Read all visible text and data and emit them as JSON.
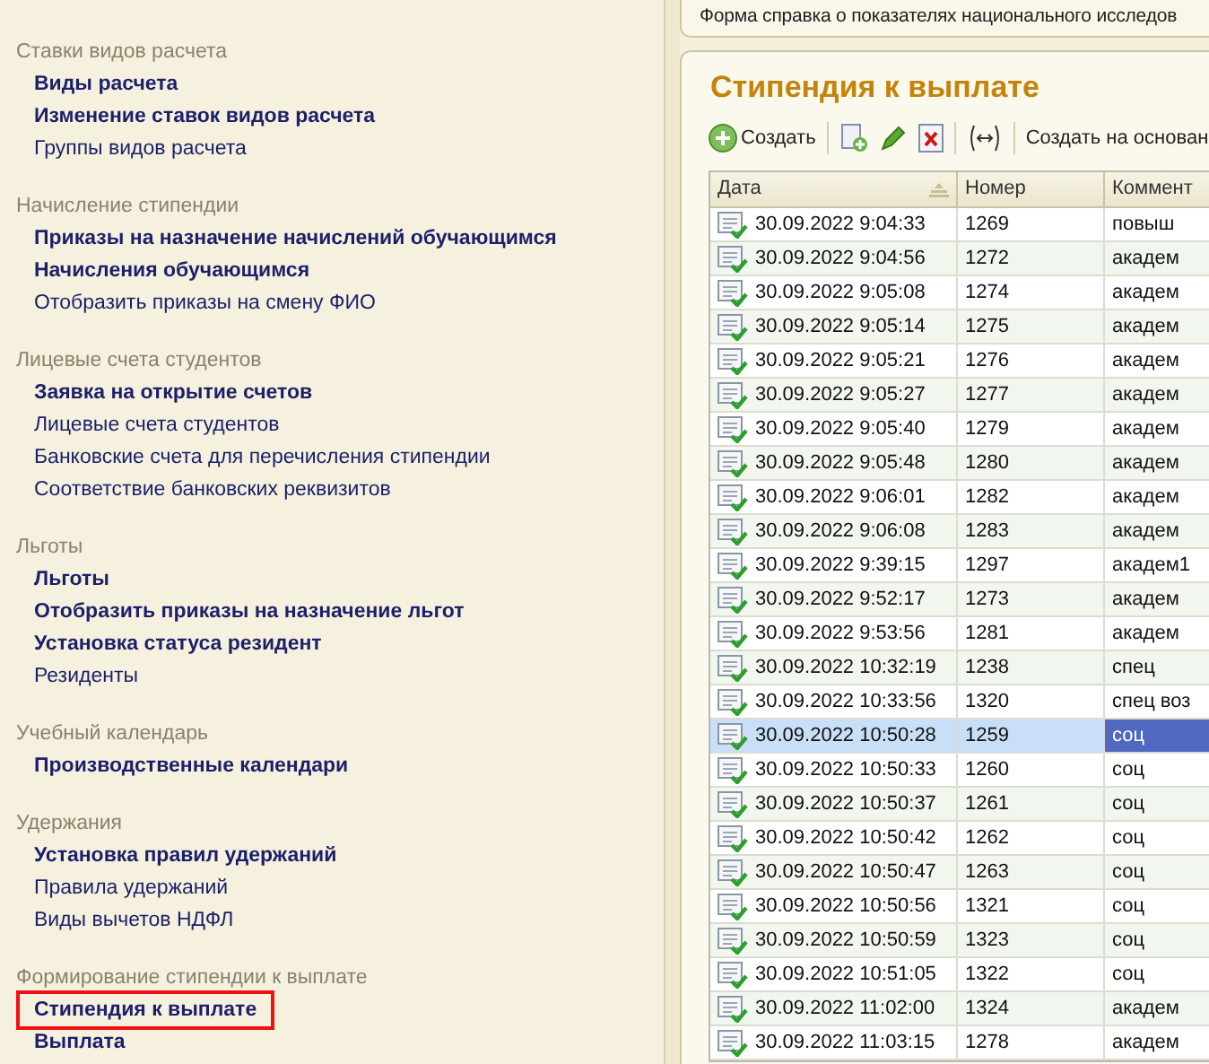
{
  "sidebar": {
    "sections": [
      {
        "title": "Ставки видов расчета",
        "items": [
          {
            "label": "Виды расчета",
            "bold": true,
            "outlined": false
          },
          {
            "label": "Изменение ставок видов расчета",
            "bold": true,
            "outlined": false
          },
          {
            "label": "Группы видов расчета",
            "bold": false,
            "outlined": false
          }
        ]
      },
      {
        "title": "Начисление стипендии",
        "items": [
          {
            "label": "Приказы на назначение начислений обучающимся",
            "bold": true,
            "outlined": false
          },
          {
            "label": "Начисления обучающимся",
            "bold": true,
            "outlined": false
          },
          {
            "label": "Отобразить приказы на смену ФИО",
            "bold": false,
            "outlined": false
          }
        ]
      },
      {
        "title": "Лицевые счета студентов",
        "items": [
          {
            "label": "Заявка на открытие счетов",
            "bold": true,
            "outlined": false
          },
          {
            "label": "Лицевые счета студентов",
            "bold": false,
            "outlined": false
          },
          {
            "label": "Банковские счета для перечисления стипендии",
            "bold": false,
            "outlined": false
          },
          {
            "label": "Соответствие банковских реквизитов",
            "bold": false,
            "outlined": false
          }
        ]
      },
      {
        "title": "Льготы",
        "items": [
          {
            "label": "Льготы",
            "bold": true,
            "outlined": false
          },
          {
            "label": "Отобразить приказы на назначение льгот",
            "bold": true,
            "outlined": false
          },
          {
            "label": "Установка статуса резидент",
            "bold": true,
            "outlined": false
          },
          {
            "label": "Резиденты",
            "bold": false,
            "outlined": false
          }
        ]
      },
      {
        "title": "Учебный календарь",
        "items": [
          {
            "label": "Производственные календари",
            "bold": true,
            "outlined": false
          }
        ]
      },
      {
        "title": "Удержания",
        "items": [
          {
            "label": "Установка правил удержаний",
            "bold": true,
            "outlined": false
          },
          {
            "label": "Правила удержаний",
            "bold": false,
            "outlined": false
          },
          {
            "label": "Виды вычетов НДФЛ",
            "bold": false,
            "outlined": false
          }
        ]
      },
      {
        "title": "Формирование стипендии к выплате",
        "items": [
          {
            "label": "Стипендия к выплате",
            "bold": true,
            "outlined": true
          },
          {
            "label": "Выплата",
            "bold": true,
            "outlined": false
          }
        ]
      }
    ]
  },
  "tab_strip": {
    "label": "Форма справка о показателях национального исследов"
  },
  "form": {
    "title": "Стипендия к выплате",
    "toolbar": [
      {
        "kind": "create",
        "label": "Создать"
      },
      {
        "kind": "separator"
      },
      {
        "kind": "copy"
      },
      {
        "kind": "edit"
      },
      {
        "kind": "delete"
      },
      {
        "kind": "separator"
      },
      {
        "kind": "link"
      },
      {
        "kind": "separator"
      },
      {
        "kind": "text",
        "label": "Создать на основан"
      }
    ],
    "table": {
      "columns": [
        "Дата",
        "Номер",
        "Коммент"
      ],
      "rows": [
        {
          "date": "30.09.2022 9:04:33",
          "number": "1269",
          "comment": "повыш",
          "selected": false
        },
        {
          "date": "30.09.2022 9:04:56",
          "number": "1272",
          "comment": "академ",
          "selected": false
        },
        {
          "date": "30.09.2022 9:05:08",
          "number": "1274",
          "comment": "академ",
          "selected": false
        },
        {
          "date": "30.09.2022 9:05:14",
          "number": "1275",
          "comment": "академ",
          "selected": false
        },
        {
          "date": "30.09.2022 9:05:21",
          "number": "1276",
          "comment": "академ",
          "selected": false
        },
        {
          "date": "30.09.2022 9:05:27",
          "number": "1277",
          "comment": "академ",
          "selected": false
        },
        {
          "date": "30.09.2022 9:05:40",
          "number": "1279",
          "comment": "академ",
          "selected": false
        },
        {
          "date": "30.09.2022 9:05:48",
          "number": "1280",
          "comment": "академ",
          "selected": false
        },
        {
          "date": "30.09.2022 9:06:01",
          "number": "1282",
          "comment": "академ",
          "selected": false
        },
        {
          "date": "30.09.2022 9:06:08",
          "number": "1283",
          "comment": "академ",
          "selected": false
        },
        {
          "date": "30.09.2022 9:39:15",
          "number": "1297",
          "comment": "академ1",
          "selected": false
        },
        {
          "date": "30.09.2022 9:52:17",
          "number": "1273",
          "comment": "академ",
          "selected": false
        },
        {
          "date": "30.09.2022 9:53:56",
          "number": "1281",
          "comment": "академ",
          "selected": false
        },
        {
          "date": "30.09.2022 10:32:19",
          "number": "1238",
          "comment": "спец",
          "selected": false
        },
        {
          "date": "30.09.2022 10:33:56",
          "number": "1320",
          "comment": "спец воз",
          "selected": false
        },
        {
          "date": "30.09.2022 10:50:28",
          "number": "1259",
          "comment": "соц",
          "selected": true
        },
        {
          "date": "30.09.2022 10:50:33",
          "number": "1260",
          "comment": "соц",
          "selected": false
        },
        {
          "date": "30.09.2022 10:50:37",
          "number": "1261",
          "comment": "соц",
          "selected": false
        },
        {
          "date": "30.09.2022 10:50:42",
          "number": "1262",
          "comment": "соц",
          "selected": false
        },
        {
          "date": "30.09.2022 10:50:47",
          "number": "1263",
          "comment": "соц",
          "selected": false
        },
        {
          "date": "30.09.2022 10:50:56",
          "number": "1321",
          "comment": "соц",
          "selected": false
        },
        {
          "date": "30.09.2022 10:50:59",
          "number": "1323",
          "comment": "соц",
          "selected": false
        },
        {
          "date": "30.09.2022 10:51:05",
          "number": "1322",
          "comment": "соц",
          "selected": false
        },
        {
          "date": "30.09.2022 11:02:00",
          "number": "1324",
          "comment": "академ",
          "selected": false
        },
        {
          "date": "30.09.2022 11:03:15",
          "number": "1278",
          "comment": "академ",
          "selected": false
        }
      ]
    }
  }
}
